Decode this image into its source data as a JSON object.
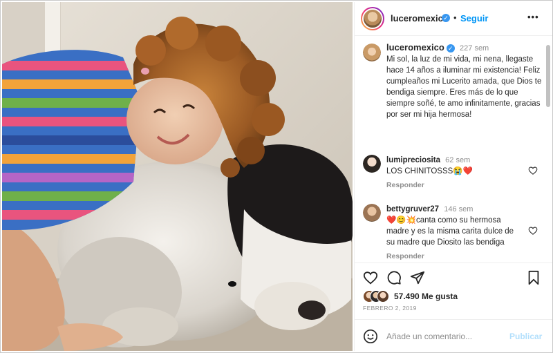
{
  "post": {
    "username": "luceromexico",
    "follow_label": "Seguir",
    "more_label": "•••",
    "verified_mark": "✓"
  },
  "caption": {
    "username": "luceromexico",
    "time": "227 sem",
    "text": "Mi sol, la luz de mi vida, mi nena, llegaste hace 14 años a iluminar mi existencia! Feliz cumpleaños mi Lucerito amada, que Dios te bendiga siempre. Eres más de lo que siempre soñé, te amo infinitamente, gracias por ser mi hija hermosa!"
  },
  "comments": [
    {
      "username": "lumipreciosita",
      "time": "62 sem",
      "text": "LOS CHINITOSSS😭❤️",
      "reply_label": "Responder"
    },
    {
      "username": "bettygruver27",
      "time": "146 sem",
      "text": "❤️😊💥canta como su hermosa madre y es la misma carita dulce de su madre que Diosito las bendiga",
      "reply_label": "Responder"
    }
  ],
  "likes": {
    "count_text": "57.490 Me gusta"
  },
  "date": "FEBRERO 2, 2019",
  "composer": {
    "placeholder": "Añade un comentario...",
    "publish_label": "Publicar"
  },
  "icons": [
    "heart-icon",
    "comment-icon",
    "share-icon",
    "bookmark-icon",
    "emoji-icon",
    "more-icon",
    "verified-icon"
  ],
  "colors": {
    "accent": "#0095f6",
    "verified": "#3897f0",
    "text": "#262626",
    "muted": "#8e8e8e",
    "publish_disabled": "#b2dffc",
    "heart": "#e0245e"
  }
}
